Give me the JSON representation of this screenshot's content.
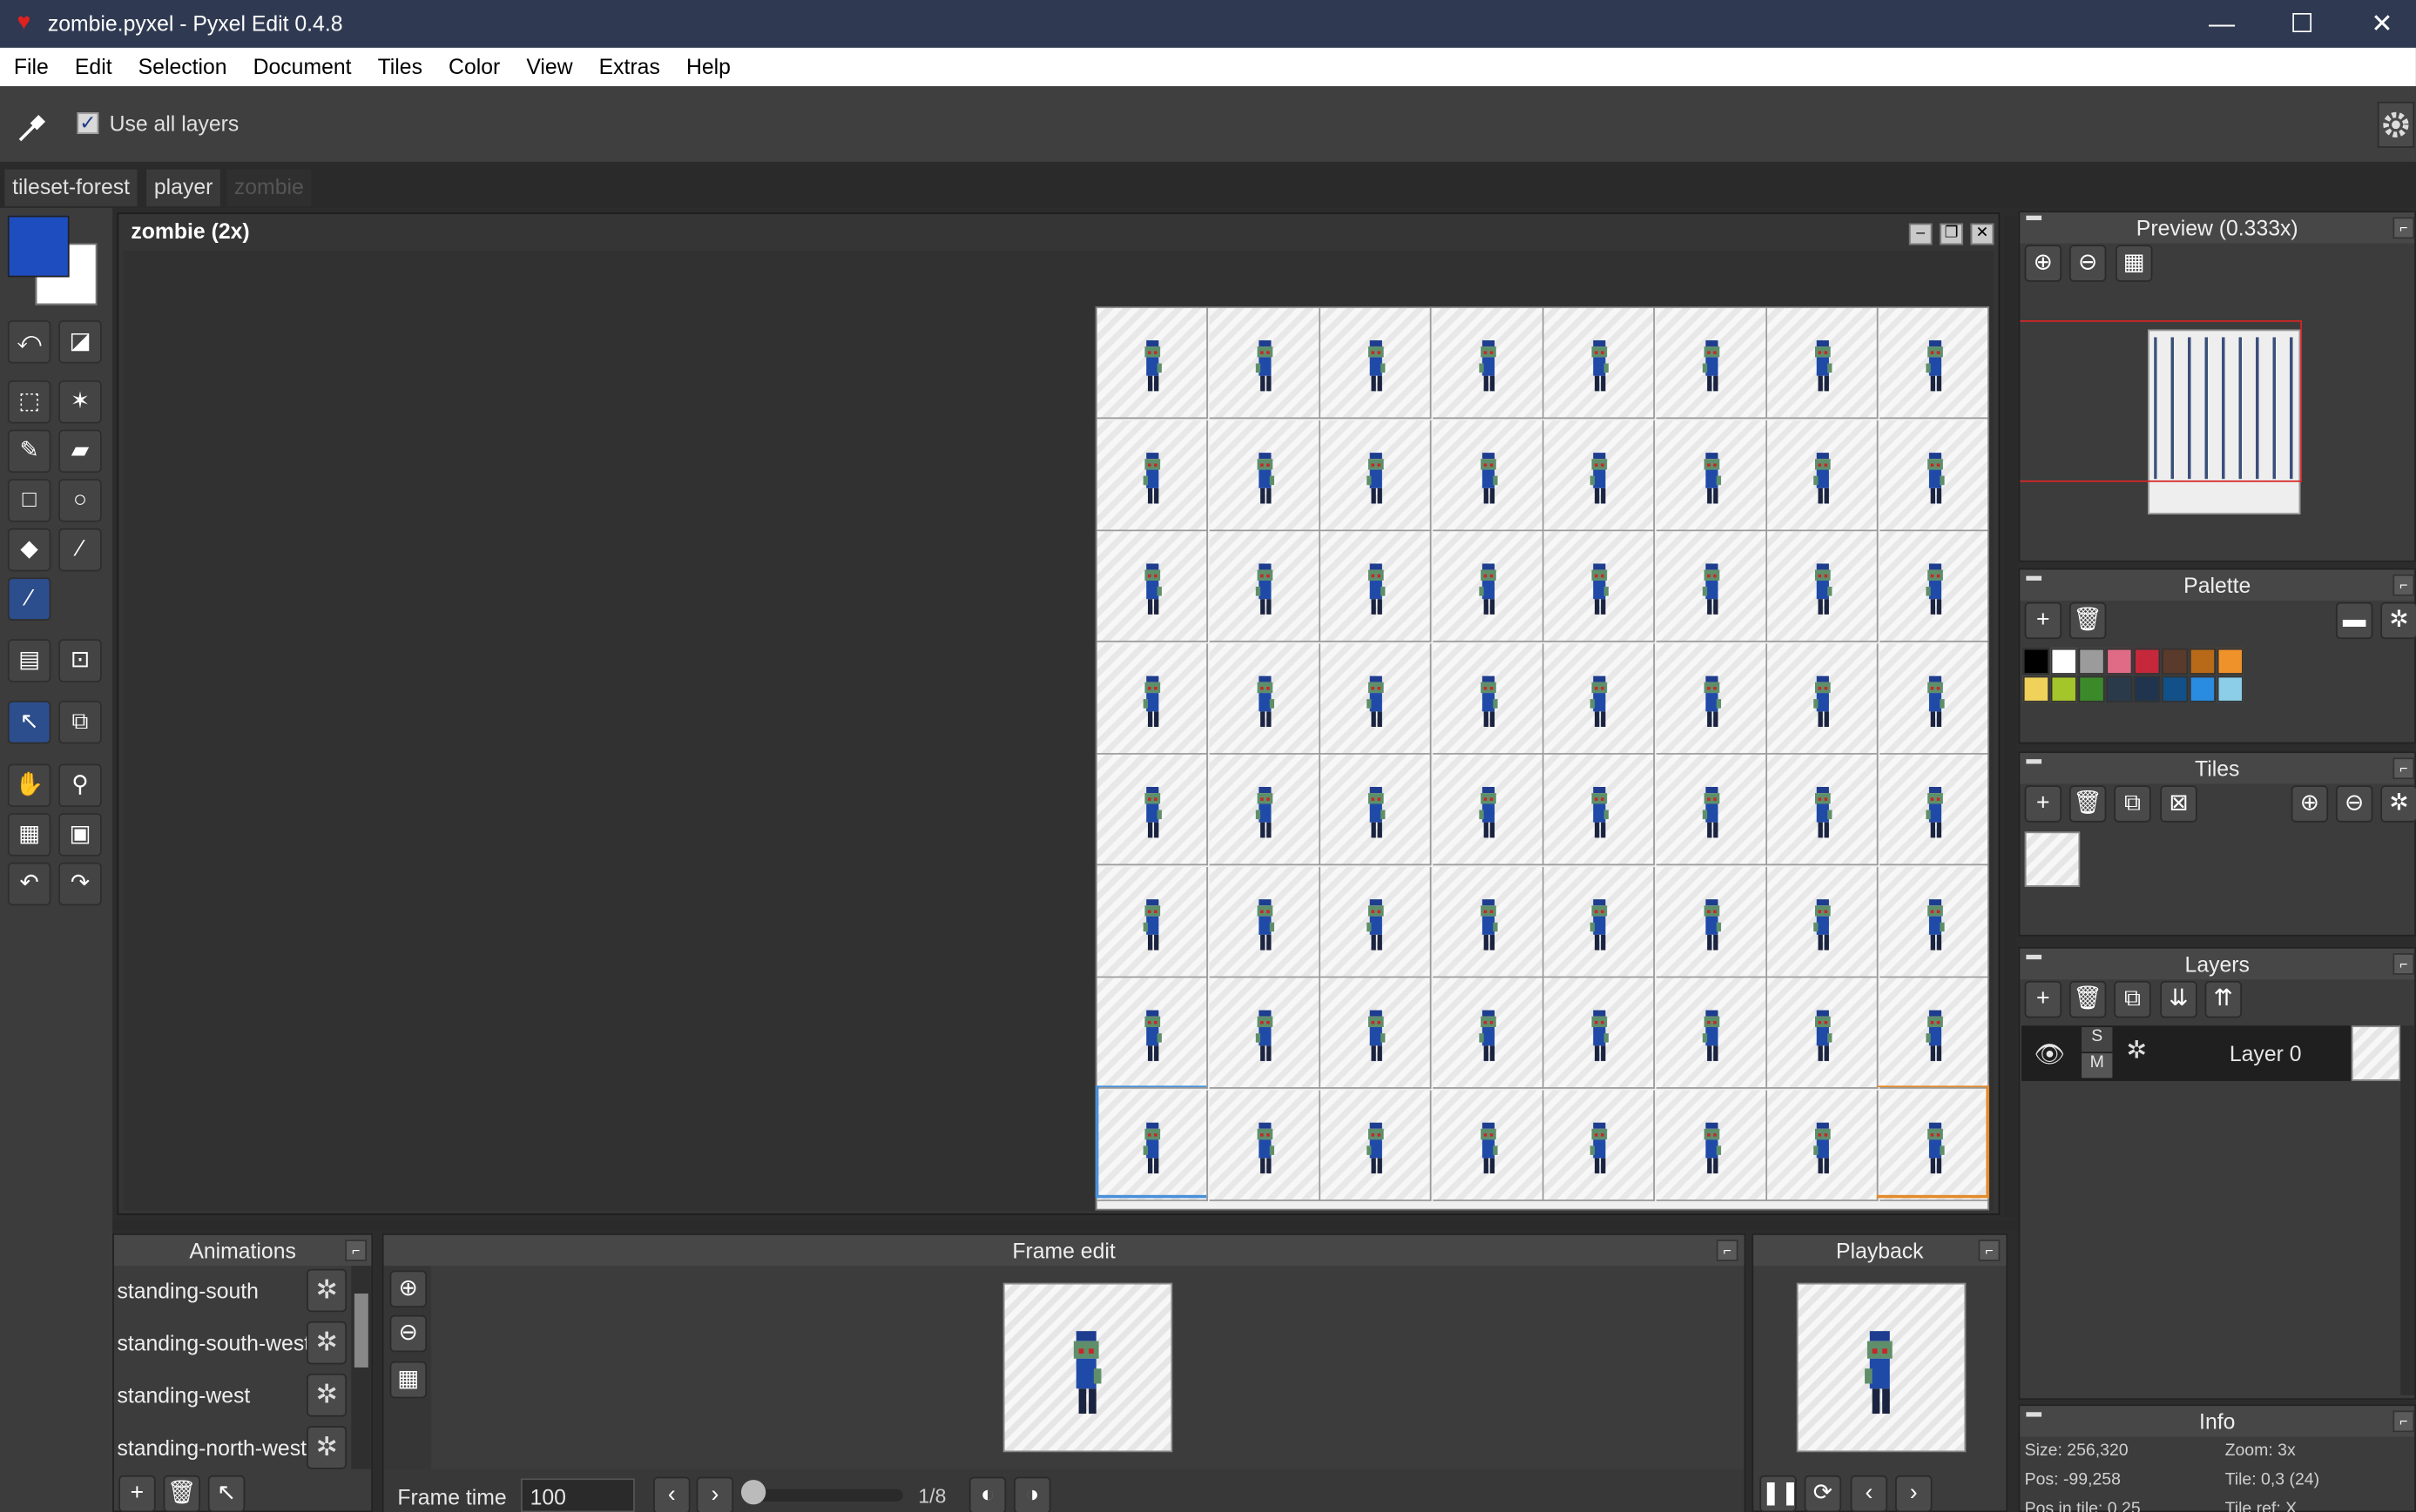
{
  "window": {
    "title": "zombie.pyxel - Pyxel Edit 0.4.8",
    "minimize": "—",
    "maximize": "☐",
    "close": "✕"
  },
  "menu": [
    "File",
    "Edit",
    "Selection",
    "Document",
    "Tiles",
    "Color",
    "View",
    "Extras",
    "Help"
  ],
  "tool_options": {
    "use_all_layers_label": "Use all layers",
    "use_all_layers_checked": true
  },
  "doc_tabs": [
    "tileset-forest",
    "player",
    "zombie"
  ],
  "canvas": {
    "title": "zombie  (2x)",
    "rows": 8,
    "cols": 8
  },
  "colors": {
    "fg": "#1e4dbf",
    "bg": "#ffffff",
    "palette": [
      "#000000",
      "#ffffff",
      "#9b9b9b",
      "#e06b86",
      "#c6283b",
      "#5a3a2a",
      "#b86a18",
      "#f0922a",
      "#f0d25a",
      "#a5c62a",
      "#3b8a2a",
      "#2a3a4a",
      "#20344e",
      "#12508a",
      "#2a8ce0",
      "#8ccde8"
    ]
  },
  "preview": {
    "title": "Preview (0.333x)"
  },
  "palette": {
    "title": "Palette"
  },
  "tiles": {
    "title": "Tiles"
  },
  "layers": {
    "title": "Layers",
    "items": [
      {
        "name": "Layer 0",
        "s": "S",
        "m": "M"
      }
    ]
  },
  "info": {
    "title": "Info",
    "size": "Size: 256,320",
    "zoom": "Zoom: 3x",
    "pos": "Pos: -99,258",
    "tile": "Tile: 0,3 (24)",
    "pos_in_tile": "Pos in tile: 0,25",
    "tile_ref": "Tile ref: X"
  },
  "animations": {
    "title": "Animations",
    "items": [
      "standing-south",
      "standing-south-west",
      "standing-west",
      "standing-north-west"
    ]
  },
  "frame_edit": {
    "title": "Frame edit",
    "frame_time_label": "Frame time",
    "frame_time_value": "100",
    "frame_counter": "1/8"
  },
  "playback": {
    "title": "Playback"
  }
}
